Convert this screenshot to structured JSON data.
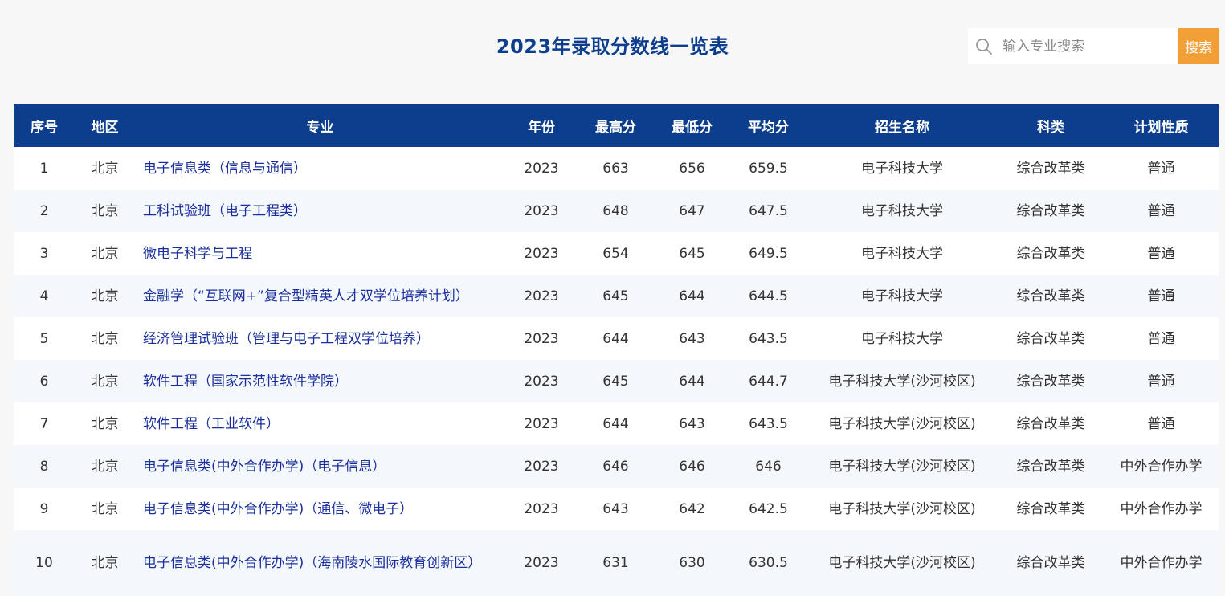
{
  "header": {
    "title": "2023年录取分数线一览表"
  },
  "search": {
    "placeholder": "输入专业搜索",
    "button_label": "搜索",
    "icon": "search-icon"
  },
  "table": {
    "columns": {
      "index": "序号",
      "region": "地区",
      "major": "专业",
      "year": "年份",
      "max": "最高分",
      "min": "最低分",
      "avg": "平均分",
      "school": "招生名称",
      "category": "科类",
      "plan": "计划性质"
    },
    "rows": [
      {
        "index": "1",
        "region": "北京",
        "major": "电子信息类（信息与通信）",
        "year": "2023",
        "max": "663",
        "min": "656",
        "avg": "659.5",
        "school": "电子科技大学",
        "category": "综合改革类",
        "plan": "普通"
      },
      {
        "index": "2",
        "region": "北京",
        "major": "工科试验班（电子工程类）",
        "year": "2023",
        "max": "648",
        "min": "647",
        "avg": "647.5",
        "school": "电子科技大学",
        "category": "综合改革类",
        "plan": "普通"
      },
      {
        "index": "3",
        "region": "北京",
        "major": "微电子科学与工程",
        "year": "2023",
        "max": "654",
        "min": "645",
        "avg": "649.5",
        "school": "电子科技大学",
        "category": "综合改革类",
        "plan": "普通"
      },
      {
        "index": "4",
        "region": "北京",
        "major": "金融学（“互联网+”复合型精英人才双学位培养计划）",
        "year": "2023",
        "max": "645",
        "min": "644",
        "avg": "644.5",
        "school": "电子科技大学",
        "category": "综合改革类",
        "plan": "普通"
      },
      {
        "index": "5",
        "region": "北京",
        "major": "经济管理试验班（管理与电子工程双学位培养）",
        "year": "2023",
        "max": "644",
        "min": "643",
        "avg": "643.5",
        "school": "电子科技大学",
        "category": "综合改革类",
        "plan": "普通"
      },
      {
        "index": "6",
        "region": "北京",
        "major": "软件工程（国家示范性软件学院）",
        "year": "2023",
        "max": "645",
        "min": "644",
        "avg": "644.7",
        "school": "电子科技大学(沙河校区)",
        "category": "综合改革类",
        "plan": "普通"
      },
      {
        "index": "7",
        "region": "北京",
        "major": "软件工程（工业软件）",
        "year": "2023",
        "max": "644",
        "min": "643",
        "avg": "643.5",
        "school": "电子科技大学(沙河校区)",
        "category": "综合改革类",
        "plan": "普通"
      },
      {
        "index": "8",
        "region": "北京",
        "major": "电子信息类(中外合作办学)（电子信息）",
        "year": "2023",
        "max": "646",
        "min": "646",
        "avg": "646",
        "school": "电子科技大学(沙河校区)",
        "category": "综合改革类",
        "plan": "中外合作办学"
      },
      {
        "index": "9",
        "region": "北京",
        "major": "电子信息类(中外合作办学)（通信、微电子）",
        "year": "2023",
        "max": "643",
        "min": "642",
        "avg": "642.5",
        "school": "电子科技大学(沙河校区)",
        "category": "综合改革类",
        "plan": "中外合作办学"
      },
      {
        "index": "10",
        "region": "北京",
        "major": "电子信息类(中外合作办学)（海南陵水国际教育创新区）",
        "year": "2023",
        "max": "631",
        "min": "630",
        "avg": "630.5",
        "school": "电子科技大学(沙河校区)",
        "category": "综合改革类",
        "plan": "中外合作办学"
      }
    ]
  }
}
